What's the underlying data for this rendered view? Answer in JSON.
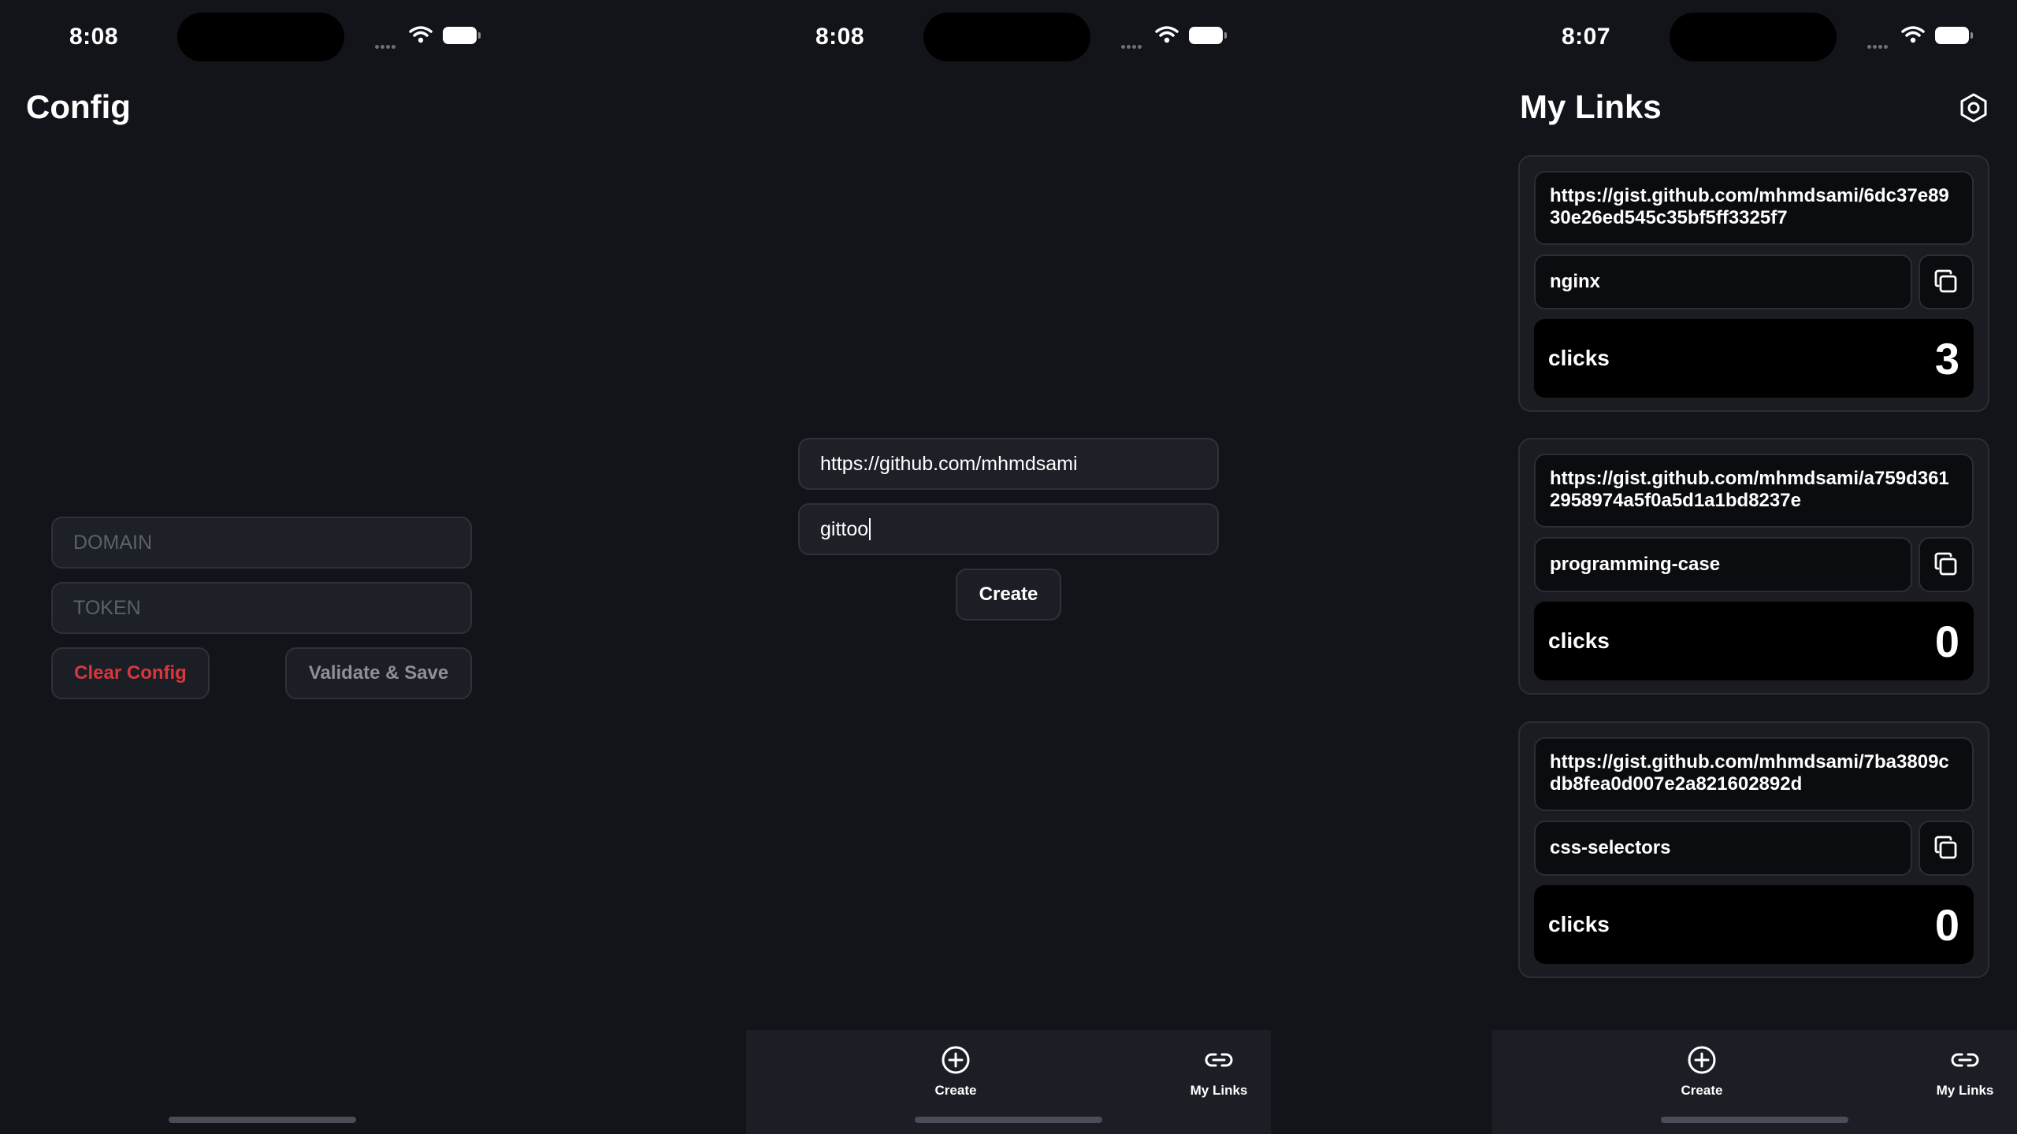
{
  "config_screen": {
    "status": {
      "time": "8:08"
    },
    "title": "Config",
    "domain_placeholder": "DOMAIN",
    "token_placeholder": "TOKEN",
    "clear_button": "Clear Config",
    "save_button": "Validate & Save",
    "colors": {
      "danger": "#d9363e",
      "muted_text": "#8e9098"
    }
  },
  "create_screen": {
    "status": {
      "time": "8:08"
    },
    "url_input_value": "https://github.com/mhmdsami",
    "slug_input_value": "gittoo",
    "create_button": "Create",
    "tabs": [
      {
        "label": "Create",
        "icon": "plus-circle-icon"
      },
      {
        "label": "My Links",
        "icon": "link-icon"
      }
    ]
  },
  "links_screen": {
    "status": {
      "time": "8:07"
    },
    "title": "My Links",
    "settings_icon": "settings-icon",
    "links": [
      {
        "url": "https://gist.github.com/mhmdsami/6dc37e8930e26ed545c35bf5ff3325f7",
        "slug": "nginx",
        "clicks_label": "clicks",
        "clicks": "3"
      },
      {
        "url": "https://gist.github.com/mhmdsami/a759d3612958974a5f0a5d1a1bd8237e",
        "slug": "programming-case",
        "clicks_label": "clicks",
        "clicks": "0"
      },
      {
        "url": "https://gist.github.com/mhmdsami/7ba3809cdb8fea0d007e2a821602892d",
        "slug": "css-selectors",
        "clicks_label": "clicks",
        "clicks": "0"
      }
    ],
    "tabs": [
      {
        "label": "Create",
        "icon": "plus-circle-icon"
      },
      {
        "label": "My Links",
        "icon": "link-icon"
      }
    ]
  }
}
